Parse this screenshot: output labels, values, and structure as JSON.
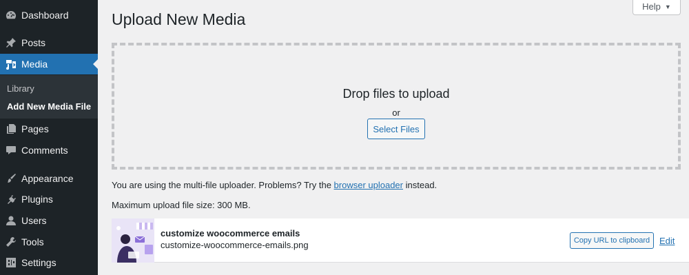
{
  "sidebar": {
    "items": [
      {
        "label": "Dashboard",
        "icon": "dashboard-icon"
      },
      {
        "label": "Posts",
        "icon": "pin-icon"
      },
      {
        "label": "Media",
        "icon": "media-icon"
      },
      {
        "label": "Pages",
        "icon": "pages-icon"
      },
      {
        "label": "Comments",
        "icon": "comment-icon"
      },
      {
        "label": "Appearance",
        "icon": "brush-icon"
      },
      {
        "label": "Plugins",
        "icon": "plugin-icon"
      },
      {
        "label": "Users",
        "icon": "user-icon"
      },
      {
        "label": "Tools",
        "icon": "wrench-icon"
      },
      {
        "label": "Settings",
        "icon": "settings-icon"
      }
    ],
    "current": "Media",
    "submenu": [
      {
        "label": "Library"
      },
      {
        "label": "Add New Media File"
      }
    ]
  },
  "header": {
    "title": "Upload New Media",
    "help_label": "Help"
  },
  "uploader": {
    "drop_title": "Drop files to upload",
    "or_text": "or",
    "select_button": "Select Files",
    "notice_prefix": "You are using the multi-file uploader. Problems? Try the",
    "notice_link": "browser uploader",
    "notice_suffix": "instead.",
    "max_size": "Maximum upload file size: 300 MB."
  },
  "media_item": {
    "title": "customize woocommerce emails",
    "filename": "customize-woocommerce-emails.png",
    "copy_button": "Copy URL to clipboard",
    "edit_link": "Edit"
  },
  "colors": {
    "sidebar_bg": "#1d2327",
    "accent": "#2271b1",
    "page_bg": "#f0f0f1"
  }
}
